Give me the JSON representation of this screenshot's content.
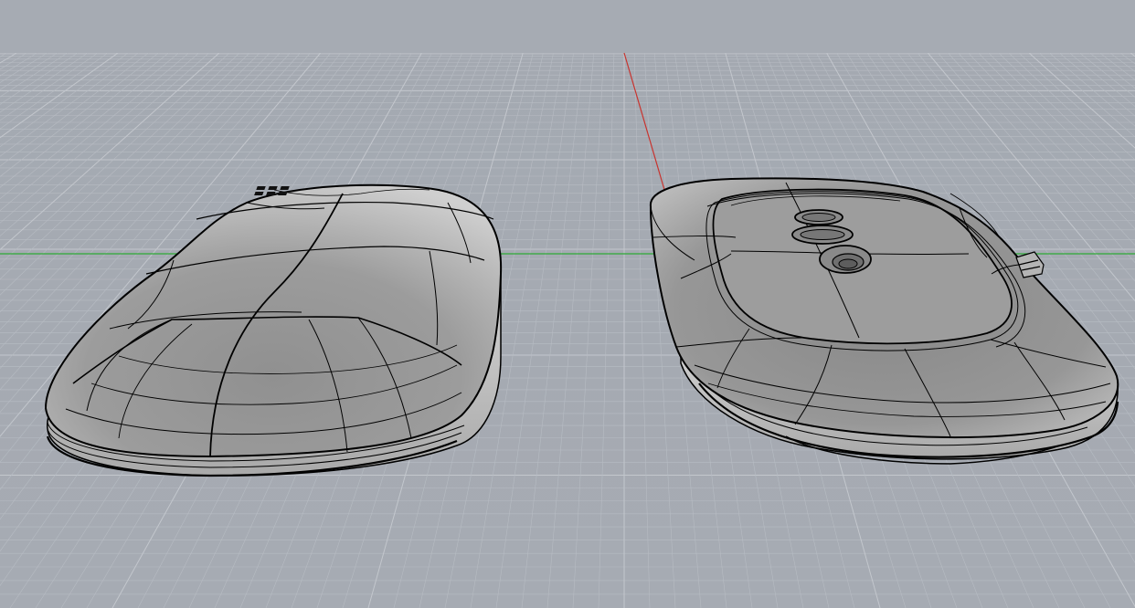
{
  "viewport": {
    "label": "",
    "background_color": "#a6abb3",
    "grid_minor_color": "#b7bcc3",
    "grid_major_color": "#c3c7cd",
    "axis_x_color": "#2faa36",
    "axis_y_color": "#c8332e",
    "shade_color": "#9a9a9a",
    "edge_color": "#000000"
  },
  "objects": [
    {
      "name": "mouse-top-shell"
    },
    {
      "name": "mouse-bottom-shell"
    }
  ]
}
